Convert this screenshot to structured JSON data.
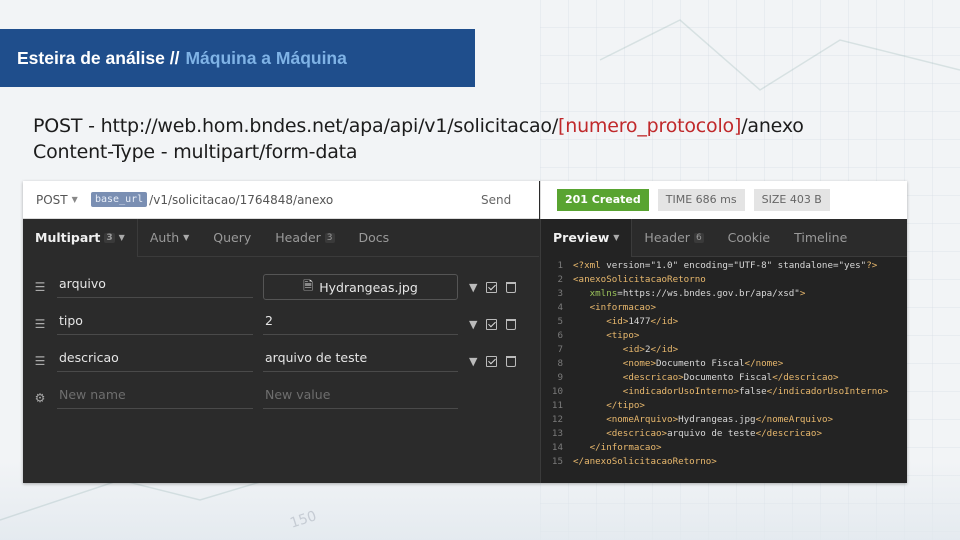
{
  "slide": {
    "title_prefix": "Esteira de análise //",
    "title_accent": "Máquina a Máquina",
    "endpoint_prefix": "POST - http://web.hom.bndes.net/apa/api/v1/solicitacao/",
    "endpoint_param": "[numero_protocolo]",
    "endpoint_suffix": "/anexo",
    "content_type": "Content-Type - multipart/form-data",
    "bg_number": "150"
  },
  "request": {
    "method": "POST",
    "base_url_pill": "base_url",
    "url_rest": "/v1/solicitacao/1764848/anexo",
    "send_label": "Send",
    "tabs": [
      {
        "label": "Multipart",
        "count": "3",
        "active": true
      },
      {
        "label": "Auth"
      },
      {
        "label": "Query"
      },
      {
        "label": "Header",
        "count": "3"
      },
      {
        "label": "Docs"
      }
    ],
    "rows": [
      {
        "name": "arquivo",
        "value": "Hydrangeas.jpg",
        "type": "file"
      },
      {
        "name": "tipo",
        "value": "2"
      },
      {
        "name": "descricao",
        "value": "arquivo de teste"
      }
    ],
    "new_name_placeholder": "New name",
    "new_value_placeholder": "New value"
  },
  "response": {
    "status": "201 Created",
    "time": "TIME 686 ms",
    "size": "SIZE 403 B",
    "tabs": [
      {
        "label": "Preview",
        "active": true
      },
      {
        "label": "Header",
        "count": "6"
      },
      {
        "label": "Cookie"
      },
      {
        "label": "Timeline"
      }
    ],
    "code_lines": [
      "<?xml version=\"1.0\" encoding=\"UTF-8\" standalone=\"yes\"?>",
      "<anexoSolicitacaoRetorno",
      "   xmlns=\"https://ws.bndes.gov.br/apa/xsd\">",
      "   <informacao>",
      "      <id>1477</id>",
      "      <tipo>",
      "         <id>2</id>",
      "         <nome>Documento Fiscal</nome>",
      "         <descricao>Documento Fiscal</descricao>",
      "         <indicadorUsoInterno>false</indicadorUsoInterno>",
      "      </tipo>",
      "      <nomeArquivo>Hydrangeas.jpg</nomeArquivo>",
      "      <descricao>arquivo de teste</descricao>",
      "   </informacao>",
      "</anexoSolicitacaoRetorno>"
    ]
  }
}
